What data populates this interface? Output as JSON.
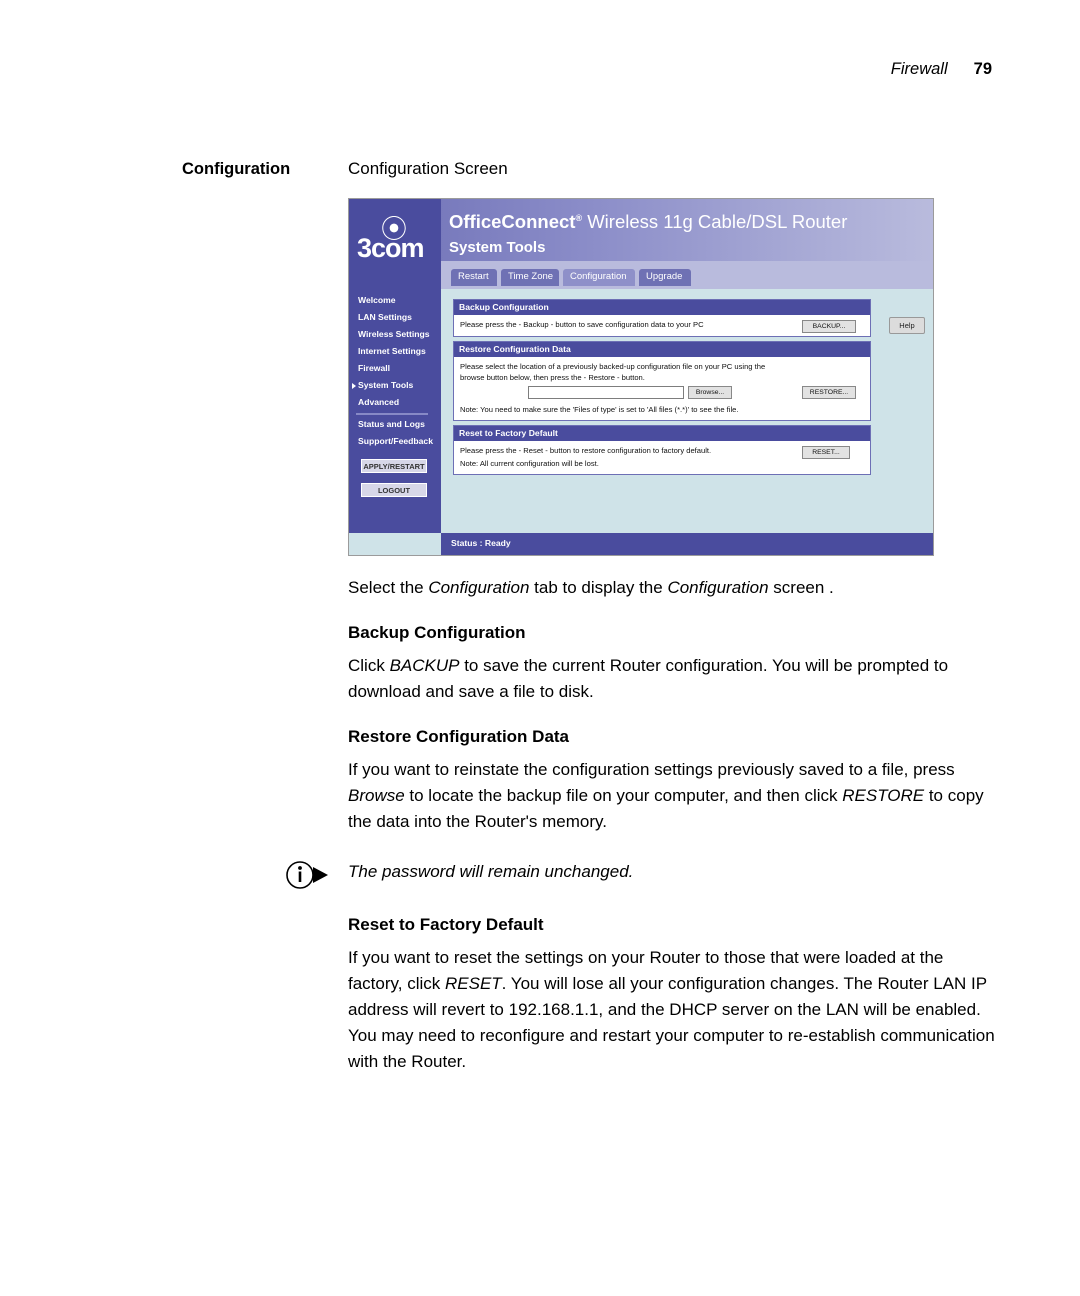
{
  "header": {
    "chapter": "Firewall",
    "page_number": "79"
  },
  "marginal_heading": "Configuration",
  "section_title": "Configuration Screen",
  "figure": {
    "product_name": "OfficeConnect",
    "product_reg": "®",
    "product_suffix": "Wireless 11g Cable/DSL Router",
    "logo_text": "3com",
    "section_label": "System Tools",
    "tabs": [
      {
        "label": "Restart",
        "active": false
      },
      {
        "label": "Time Zone",
        "active": false
      },
      {
        "label": "Configuration",
        "active": true
      },
      {
        "label": "Upgrade",
        "active": false
      }
    ],
    "sidebar": [
      "Welcome",
      "LAN Settings",
      "Wireless Settings",
      "Internet Settings",
      "Firewall",
      "System Tools",
      "Advanced",
      "Status and Logs",
      "Support/Feedback"
    ],
    "sidebar_selected": "System Tools",
    "sidebar_buttons": [
      "APPLY/RESTART",
      "LOGOUT"
    ],
    "help_button": "Help",
    "panels": [
      {
        "title": "Backup Configuration",
        "body": "Please press the - Backup - button to save configuration data to your PC",
        "button": "BACKUP..."
      },
      {
        "title": "Restore Configuration Data",
        "body_line1": "Please select the location of a previously backed-up configuration file on your PC using the",
        "body_line2": "browse button below, then press the - Restore - button.",
        "browse_button": "Browse...",
        "restore_button": "RESTORE...",
        "field_value": "",
        "note": "Note: You need to make sure the 'Files of type' is set to 'All files (*.*)' to see the file."
      },
      {
        "title": "Reset to Factory Default",
        "body": "Please press the - Reset - button to restore configuration to factory default.",
        "button": "RESET...",
        "note": "Note: All current configuration will be lost."
      }
    ],
    "status_bar": "Status : Ready"
  },
  "body": {
    "intro_1": "Select the ",
    "intro_i1": "Configuration",
    "intro_2": " tab to display the ",
    "intro_i2": "Configuration",
    "intro_3": " screen .",
    "h_backup": "Backup Configuration",
    "p_backup_1": "Click ",
    "p_backup_i1": "BACKUP",
    "p_backup_2": " to save the current Router configuration. You will be prompted to download and save a file to disk.",
    "h_restore": "Restore Configuration Data",
    "p_restore_1": "If you want to reinstate the configuration settings previously saved to a file, press ",
    "p_restore_i1": "Browse",
    "p_restore_2": " to locate the backup file on your computer, and then click ",
    "p_restore_i2": "RESTORE",
    "p_restore_3": " to copy the data into the Router's memory.",
    "note": "The password will remain unchanged.",
    "h_reset": "Reset to Factory Default",
    "p_reset_1": "If you want to reset the settings on your Router to those that were loaded at the factory, click ",
    "p_reset_i1": "RESET",
    "p_reset_2": ". You will lose all your configuration changes. The Router LAN IP address will revert to 192.168.1.1, and the DHCP server on the LAN will be enabled. You may need to reconfigure and restart your computer to re-establish communication with the Router."
  }
}
